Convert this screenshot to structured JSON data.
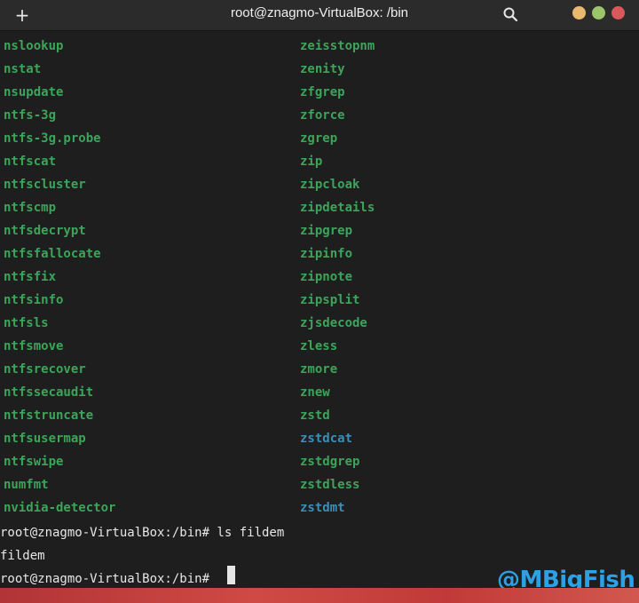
{
  "window": {
    "title": "root@znagmo-VirtualBox: /bin",
    "new_tab_icon": "+",
    "controls": {
      "minimize_color": "#e9b96e",
      "maximize_color": "#9bc46b",
      "close_color": "#d9585c"
    }
  },
  "listing": {
    "left": [
      "nslookup",
      "nstat",
      "nsupdate",
      "ntfs-3g",
      "ntfs-3g.probe",
      "ntfscat",
      "ntfscluster",
      "ntfscmp",
      "ntfsdecrypt",
      "ntfsfallocate",
      "ntfsfix",
      "ntfsinfo",
      "ntfsls",
      "ntfsmove",
      "ntfsrecover",
      "ntfssecaudit",
      "ntfstruncate",
      "ntfsusermap",
      "ntfswipe",
      "numfmt",
      "nvidia-detector"
    ],
    "right": [
      "zeisstopnm",
      "zenity",
      "zfgrep",
      "zforce",
      "zgrep",
      "zip",
      "zipcloak",
      "zipdetails",
      "zipgrep",
      "zipinfo",
      "zipnote",
      "zipsplit",
      "zjsdecode",
      "zless",
      "zmore",
      "znew",
      "zstd",
      "zstdcat",
      "zstdgrep",
      "zstdless",
      "zstdmt"
    ],
    "right_symlink_items": [
      "zstdcat",
      "zstdmt"
    ],
    "executable_color": "#3ca55a",
    "symlink_color": "#3a8fb8"
  },
  "session": {
    "command_line": "root@znagmo-VirtualBox:/bin# ls fildem",
    "output": "fildem",
    "prompt": "root@znagmo-VirtualBox:/bin#"
  },
  "watermark": "@MBigFish"
}
